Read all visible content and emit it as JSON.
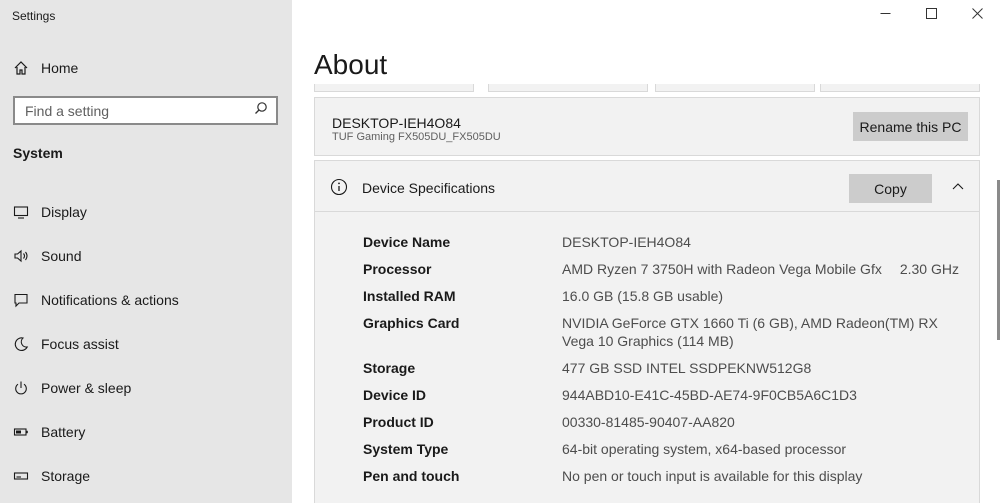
{
  "app": {
    "title": "Settings"
  },
  "sidebar": {
    "home_label": "Home",
    "search_placeholder": "Find a setting",
    "section": "System",
    "items": [
      {
        "label": "Display",
        "icon": "display-icon"
      },
      {
        "label": "Sound",
        "icon": "sound-icon"
      },
      {
        "label": "Notifications & actions",
        "icon": "notifications-icon"
      },
      {
        "label": "Focus assist",
        "icon": "focus-assist-icon"
      },
      {
        "label": "Power & sleep",
        "icon": "power-icon"
      },
      {
        "label": "Battery",
        "icon": "battery-icon"
      },
      {
        "label": "Storage",
        "icon": "storage-icon"
      }
    ]
  },
  "main": {
    "title": "About",
    "pc": {
      "name": "DESKTOP-IEH4O84",
      "model": "TUF Gaming FX505DU_FX505DU",
      "rename_label": "Rename this PC"
    },
    "specs": {
      "title": "Device Specifications",
      "copy_label": "Copy",
      "rows": [
        {
          "key": "Device Name",
          "value": "DESKTOP-IEH4O84"
        },
        {
          "key": "Processor",
          "value": "AMD Ryzen 7 3750H with Radeon Vega Mobile Gfx",
          "value2": "2.30 GHz"
        },
        {
          "key": "Installed RAM",
          "value": "16.0 GB (15.8 GB usable)"
        },
        {
          "key": "Graphics Card",
          "value": "NVIDIA GeForce GTX 1660 Ti (6 GB), AMD Radeon(TM) RX Vega 10 Graphics (114 MB)"
        },
        {
          "key": "Storage",
          "value": "477 GB SSD INTEL SSDPEKNW512G8"
        },
        {
          "key": "Device ID",
          "value": "944ABD10-E41C-45BD-AE74-9F0CB5A6C1D3"
        },
        {
          "key": "Product ID",
          "value": "00330-81485-90407-AA820"
        },
        {
          "key": "System Type",
          "value": "64-bit operating system, x64-based processor"
        },
        {
          "key": "Pen and touch",
          "value": "No pen or touch input is available for this display"
        }
      ]
    }
  },
  "colors": {
    "sidebar_bg": "#e6e6e6",
    "card_bg": "#f2f2f2",
    "button_bg": "#cccccc"
  }
}
